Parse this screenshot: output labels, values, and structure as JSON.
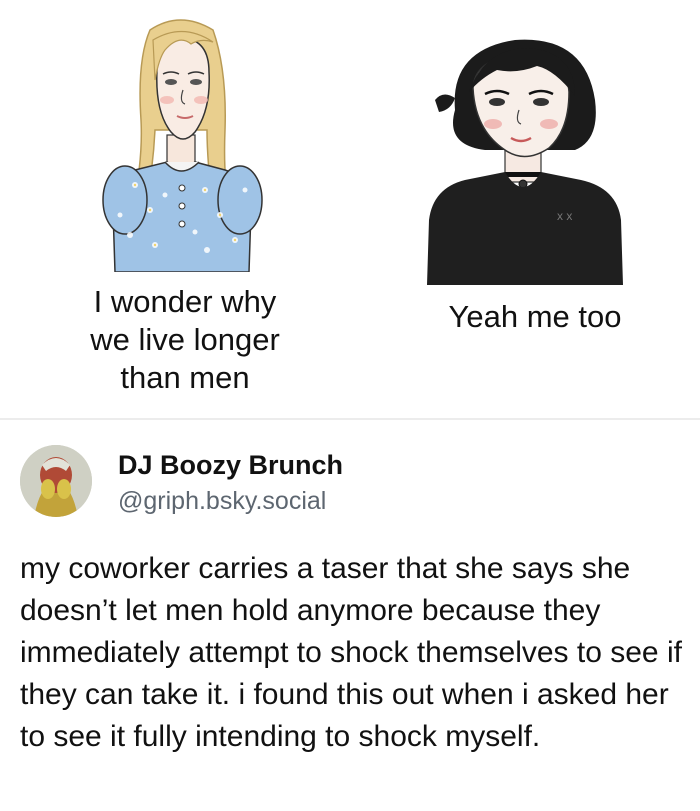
{
  "meme": {
    "left_caption": "I wonder why\nwe live longer\nthan men",
    "right_caption": "Yeah me too"
  },
  "post": {
    "display_name": "DJ Boozy Brunch",
    "handle": "@griph.bsky.social",
    "text": "my coworker carries a taser that she says she doesn’t let men hold anymore because they immediately attempt to shock themselves to see if they can take it. i found this out when i asked her to see it fully intending to shock myself."
  },
  "colors": {
    "blonde_hair": "#e9cf8e",
    "floral_dress": "#9fc3e6",
    "black_hair": "#1b1b1b",
    "black_shirt": "#1f1f1f",
    "handle_gray": "#5d6670"
  },
  "icons": {
    "avatar": "avatar-icon"
  }
}
